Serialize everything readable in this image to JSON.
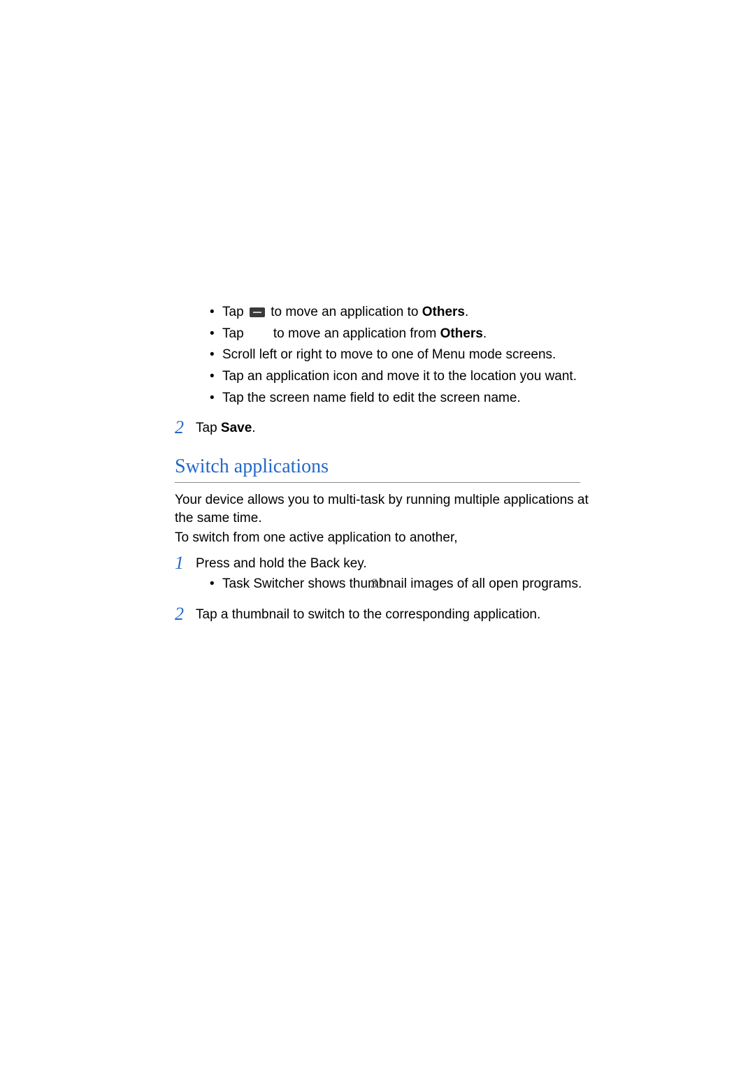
{
  "bullets": {
    "item1_pre": "Tap ",
    "item1_post": " to move an application to ",
    "item1_bold": "Others",
    "item1_end": ".",
    "item2_pre": "Tap ",
    "item2_gap": "      ",
    "item2_post": " to move an application from ",
    "item2_bold": "Others",
    "item2_end": ".",
    "item3": "Scroll left or right to move to one of Menu mode screens.",
    "item4": "Tap an application icon and move it to the location you want.",
    "item5": "Tap the screen name field to edit the screen name."
  },
  "step2a": {
    "number": "2",
    "text_pre": "Tap ",
    "text_bold": "Save",
    "text_end": "."
  },
  "heading": "Switch applications",
  "para1": "Your device allows you to multi-task by running multiple applications at the same time.",
  "para2": "To switch from one active application to another,",
  "step1": {
    "number": "1",
    "text": "Press and hold the Back key.",
    "sub": "Task Switcher shows thumbnail images of all open programs."
  },
  "step2b": {
    "number": "2",
    "text": "Tap a thumbnail to switch to the corresponding application."
  },
  "page_number": "31"
}
